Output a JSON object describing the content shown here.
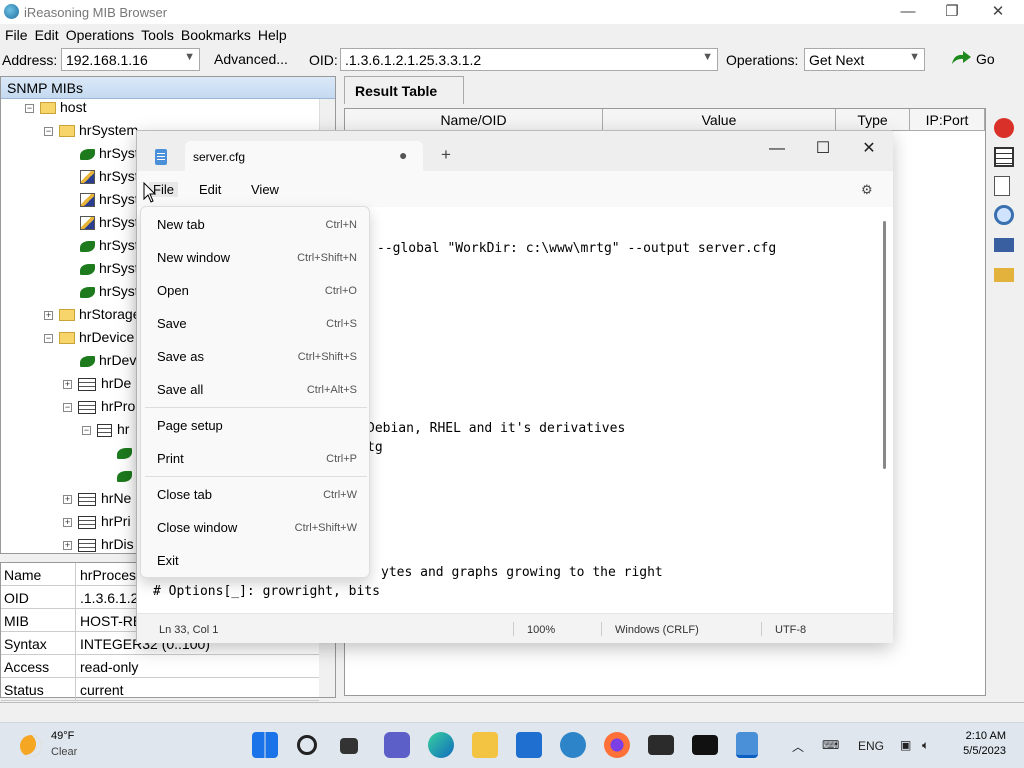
{
  "mib": {
    "title": "iReasoning MIB Browser",
    "menu": [
      "File",
      "Edit",
      "Operations",
      "Tools",
      "Bookmarks",
      "Help"
    ],
    "address_label": "Address:",
    "address_value": "192.168.1.16",
    "advanced_label": "Advanced...",
    "oid_label": "OID:",
    "oid_value": ".1.3.6.1.2.1.25.3.3.1.2",
    "operations_label": "Operations:",
    "operations_value": "Get Next",
    "go_label": "Go",
    "tree_header": "SNMP MIBs",
    "tree": [
      {
        "label": "host",
        "icon": "folder-icon"
      },
      {
        "label": "hrSystem",
        "icon": "folder-icon"
      },
      {
        "label": "hrSyst",
        "icon": "leaf-icon"
      },
      {
        "label": "hrSyst",
        "icon": "pencil-icon"
      },
      {
        "label": "hrSyst",
        "icon": "pencil-icon"
      },
      {
        "label": "hrSyst",
        "icon": "pencil-icon"
      },
      {
        "label": "hrSyst",
        "icon": "leaf-icon"
      },
      {
        "label": "hrSyst",
        "icon": "leaf-icon"
      },
      {
        "label": "hrSyst",
        "icon": "leaf-icon"
      },
      {
        "label": "hrStorage",
        "icon": "folder-icon"
      },
      {
        "label": "hrDevice",
        "icon": "folder-icon"
      },
      {
        "label": "hrDev",
        "icon": "leaf-icon"
      },
      {
        "label": "hrDe",
        "icon": "table-icon"
      },
      {
        "label": "hrPro",
        "icon": "table-icon"
      },
      {
        "label": "hr",
        "icon": "entry-icon"
      },
      {
        "label": "",
        "icon": "leaf-icon"
      },
      {
        "label": "",
        "icon": "leaf-icon"
      },
      {
        "label": "hrNe",
        "icon": "table-icon"
      },
      {
        "label": "hrPri",
        "icon": "table-icon"
      },
      {
        "label": "hrDis",
        "icon": "table-icon"
      }
    ],
    "props": [
      {
        "k": "Name",
        "v": "hrProces"
      },
      {
        "k": "OID",
        "v": ".1.3.6.1.2"
      },
      {
        "k": "MIB",
        "v": "HOST-RE"
      },
      {
        "k": "Syntax",
        "v": "INTEGER32 (0..100)"
      },
      {
        "k": "Access",
        "v": "read-only"
      },
      {
        "k": "Status",
        "v": "current"
      }
    ],
    "result_tab": "Result Table",
    "columns": [
      "Name/OID",
      "Value",
      "Type",
      "IP:Port"
    ]
  },
  "notepad": {
    "tab_name": "server.cfg",
    "menu": [
      "File",
      "Edit",
      "View"
    ],
    "lines": [
      "--global \"WorkDir: c:\\www\\mrtg\" --output server.cfg",
      "Debian, RHEL and it's derivatives",
      "tg",
      "ytes and graphs growing to the right",
      "# Options[_]: growright, bits"
    ],
    "status": {
      "pos": "Ln 33, Col 1",
      "zoom": "100%",
      "eol": "Windows (CRLF)",
      "enc": "UTF-8"
    }
  },
  "file_menu": [
    {
      "label": "New tab",
      "shortcut": "Ctrl+N"
    },
    {
      "label": "New window",
      "shortcut": "Ctrl+Shift+N"
    },
    {
      "label": "Open",
      "shortcut": "Ctrl+O"
    },
    {
      "label": "Save",
      "shortcut": "Ctrl+S"
    },
    {
      "label": "Save as",
      "shortcut": "Ctrl+Shift+S"
    },
    {
      "label": "Save all",
      "shortcut": "Ctrl+Alt+S"
    },
    {
      "label": "Page setup",
      "shortcut": ""
    },
    {
      "label": "Print",
      "shortcut": "Ctrl+P"
    },
    {
      "label": "Close tab",
      "shortcut": "Ctrl+W"
    },
    {
      "label": "Close window",
      "shortcut": "Ctrl+Shift+W"
    },
    {
      "label": "Exit",
      "shortcut": ""
    }
  ],
  "taskbar": {
    "temp": "49°F",
    "condition": "Clear",
    "lang": "ENG",
    "time": "2:10 AM",
    "date": "5/5/2023"
  }
}
